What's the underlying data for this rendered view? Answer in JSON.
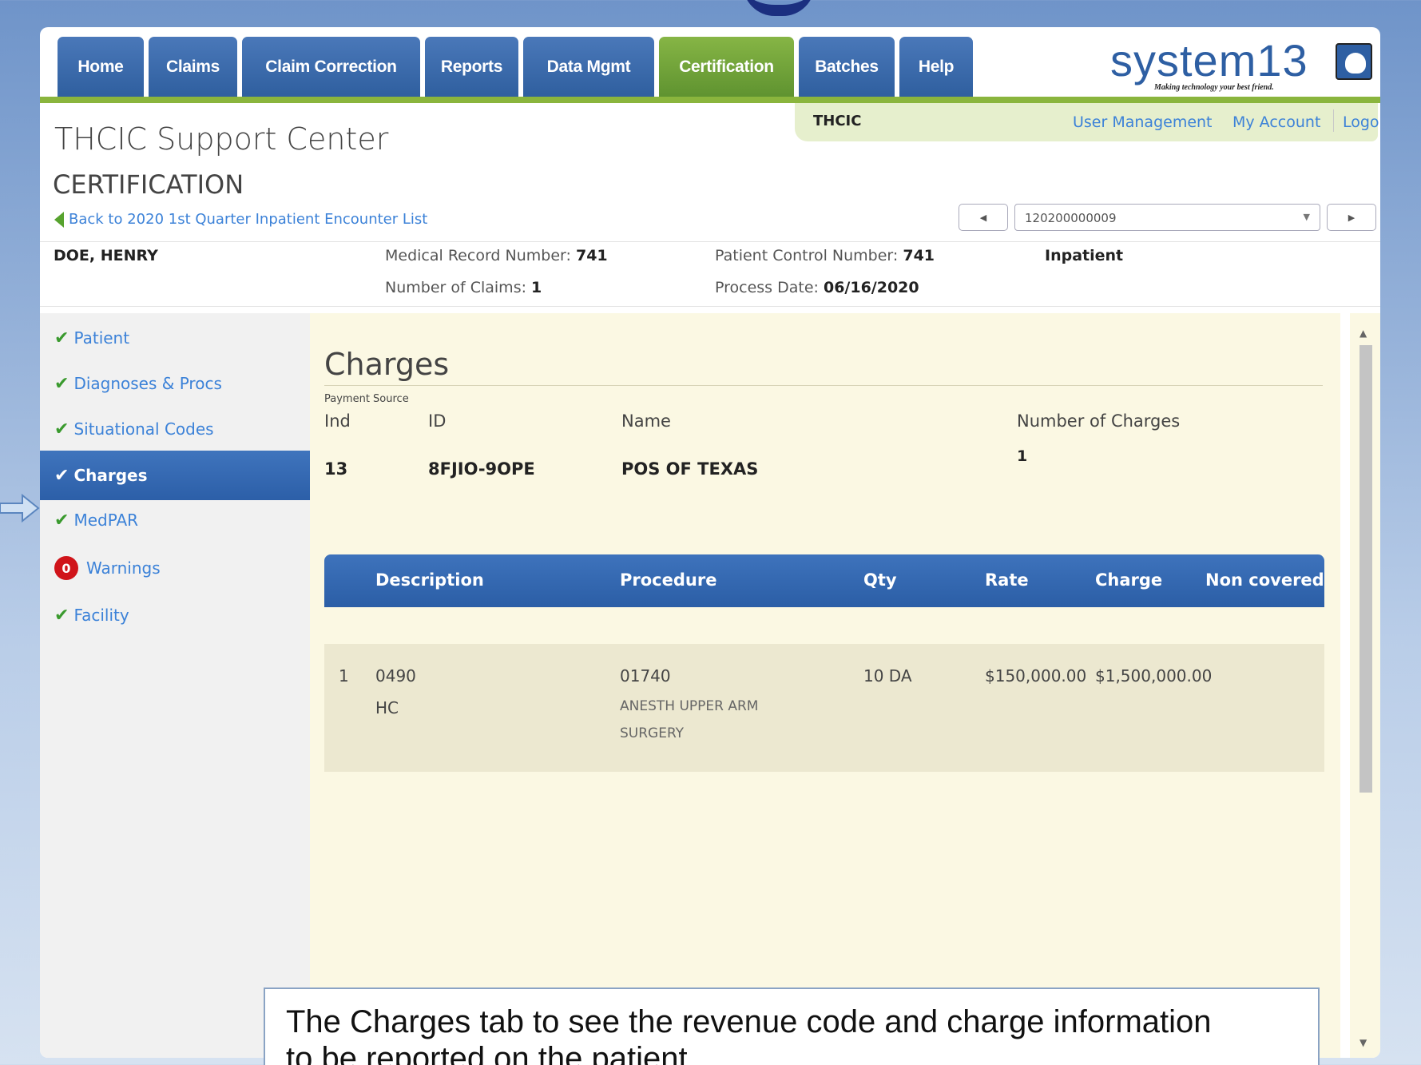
{
  "nav": {
    "tabs": [
      {
        "label": "Home"
      },
      {
        "label": "Claims"
      },
      {
        "label": "Claim Correction"
      },
      {
        "label": "Reports"
      },
      {
        "label": "Data Mgmt"
      },
      {
        "label": "Certification",
        "active": true
      },
      {
        "label": "Batches"
      },
      {
        "label": "Help"
      }
    ],
    "logo_text": "system13",
    "logo_tagline": "Making technology your best friend."
  },
  "header": {
    "org": "THCIC",
    "user_management": "User Management",
    "my_account": "My Account",
    "logout": "Logout",
    "app_title": "THCIC Support Center",
    "section": "CERTIFICATION",
    "back_link": "Back to 2020 1st Quarter Inpatient Encounter List",
    "encounter_select": "120200000009"
  },
  "patient": {
    "name": "DOE, HENRY",
    "mrn_label": "Medical Record Number:",
    "mrn": "741",
    "claims_label": "Number of Claims:",
    "claims": "1",
    "pcn_label": "Patient Control Number:",
    "pcn": "741",
    "process_date_label": "Process Date:",
    "process_date": "06/16/2020",
    "type": "Inpatient"
  },
  "sidebar": {
    "items": [
      {
        "label": "Patient"
      },
      {
        "label": "Diagnoses & Procs"
      },
      {
        "label": "Situational Codes"
      },
      {
        "label": "Charges"
      },
      {
        "label": "MedPAR"
      },
      {
        "label": "Warnings",
        "count": "0"
      },
      {
        "label": "Facility"
      }
    ]
  },
  "charges": {
    "title": "Charges",
    "payment_source_label": "Payment Source",
    "headers": {
      "ind": "Ind",
      "id": "ID",
      "name": "Name",
      "num_charges": "Number of Charges"
    },
    "values": {
      "ind": "13",
      "id": "8FJIO-9OPE",
      "name": "POS OF TEXAS",
      "num_charges": "1"
    },
    "table": {
      "columns": [
        "Description",
        "Procedure",
        "Qty",
        "Rate",
        "Charge",
        "Non covered"
      ],
      "rows": [
        {
          "num": "1",
          "desc_code": "0490",
          "desc_sub": "HC",
          "procedure": "01740",
          "procedure_desc_1": "ANESTH UPPER ARM",
          "procedure_desc_2": "SURGERY",
          "qty": "10 DA",
          "rate": "$150,000.00",
          "charge": "$1,500,000.00",
          "non_covered": ""
        }
      ]
    }
  },
  "callout": {
    "line1": "The Charges tab to see the revenue code and charge information",
    "line2": "to be reported on the patient"
  },
  "colors": {
    "nav_blue": "#2f5f9f",
    "nav_active_green": "#6ea338",
    "link_blue": "#3c82d8",
    "content_bg": "#fbf8e3",
    "warning_red": "#d0141a"
  }
}
